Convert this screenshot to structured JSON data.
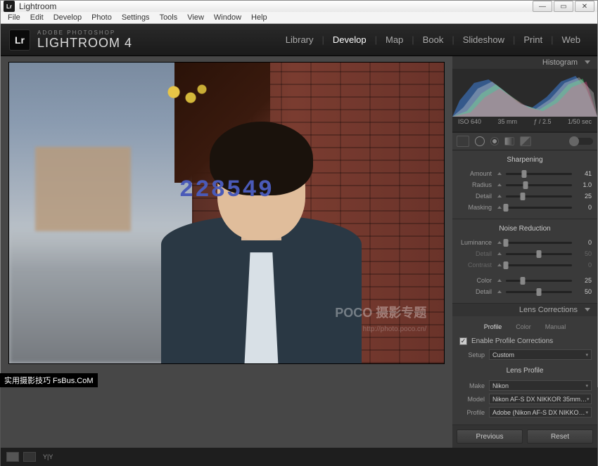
{
  "window": {
    "title": "Lightroom"
  },
  "menubar": [
    "File",
    "Edit",
    "Develop",
    "Photo",
    "Settings",
    "Tools",
    "View",
    "Window",
    "Help"
  ],
  "brand": {
    "sub": "ADOBE PHOTOSHOP",
    "main": "LIGHTROOM 4",
    "badge": "Lr"
  },
  "modules": [
    "Library",
    "Develop",
    "Map",
    "Book",
    "Slideshow",
    "Print",
    "Web"
  ],
  "active_module": "Develop",
  "histogram": {
    "title": "Histogram",
    "meta": {
      "iso": "ISO 640",
      "focal": "35 mm",
      "aperture": "ƒ / 2.5",
      "shutter": "1/50 sec"
    }
  },
  "sharpening": {
    "title": "Sharpening",
    "amount": {
      "label": "Amount",
      "value": 41,
      "pct": 28
    },
    "radius": {
      "label": "Radius",
      "value": "1.0",
      "pct": 30
    },
    "detail": {
      "label": "Detail",
      "value": 25,
      "pct": 25
    },
    "masking": {
      "label": "Masking",
      "value": 0,
      "pct": 0
    }
  },
  "noise": {
    "title": "Noise Reduction",
    "luminance": {
      "label": "Luminance",
      "value": 0,
      "pct": 0
    },
    "detail": {
      "label": "Detail",
      "value": 50,
      "pct": 50,
      "dim": true
    },
    "contrast": {
      "label": "Contrast",
      "value": 0,
      "pct": 0,
      "dim": true
    },
    "color": {
      "label": "Color",
      "value": 25,
      "pct": 25
    },
    "cdetail": {
      "label": "Detail",
      "value": 50,
      "pct": 50
    }
  },
  "lens": {
    "title": "Lens Corrections",
    "tabs": [
      "Profile",
      "Color",
      "Manual"
    ],
    "active_tab": "Profile",
    "enable_label": "Enable Profile Corrections",
    "enabled": true,
    "setup_label": "Setup",
    "setup_value": "Custom",
    "profile_head": "Lens Profile",
    "make_label": "Make",
    "make_value": "Nikon",
    "model_label": "Model",
    "model_value": "Nikon AF-S DX NIKKOR 35mm…",
    "profile_label": "Profile",
    "profile_value": "Adobe (Nikon AF-S DX NIKKO…"
  },
  "buttons": {
    "previous": "Previous",
    "reset": "Reset"
  },
  "footer": {
    "compare": "Y|Y"
  },
  "watermark": {
    "num": "228549",
    "poco": "POCO 摄影专题",
    "poco_url": "http://photo.poco.cn/",
    "outer": "实用摄影技巧 FsBus.CoM"
  }
}
